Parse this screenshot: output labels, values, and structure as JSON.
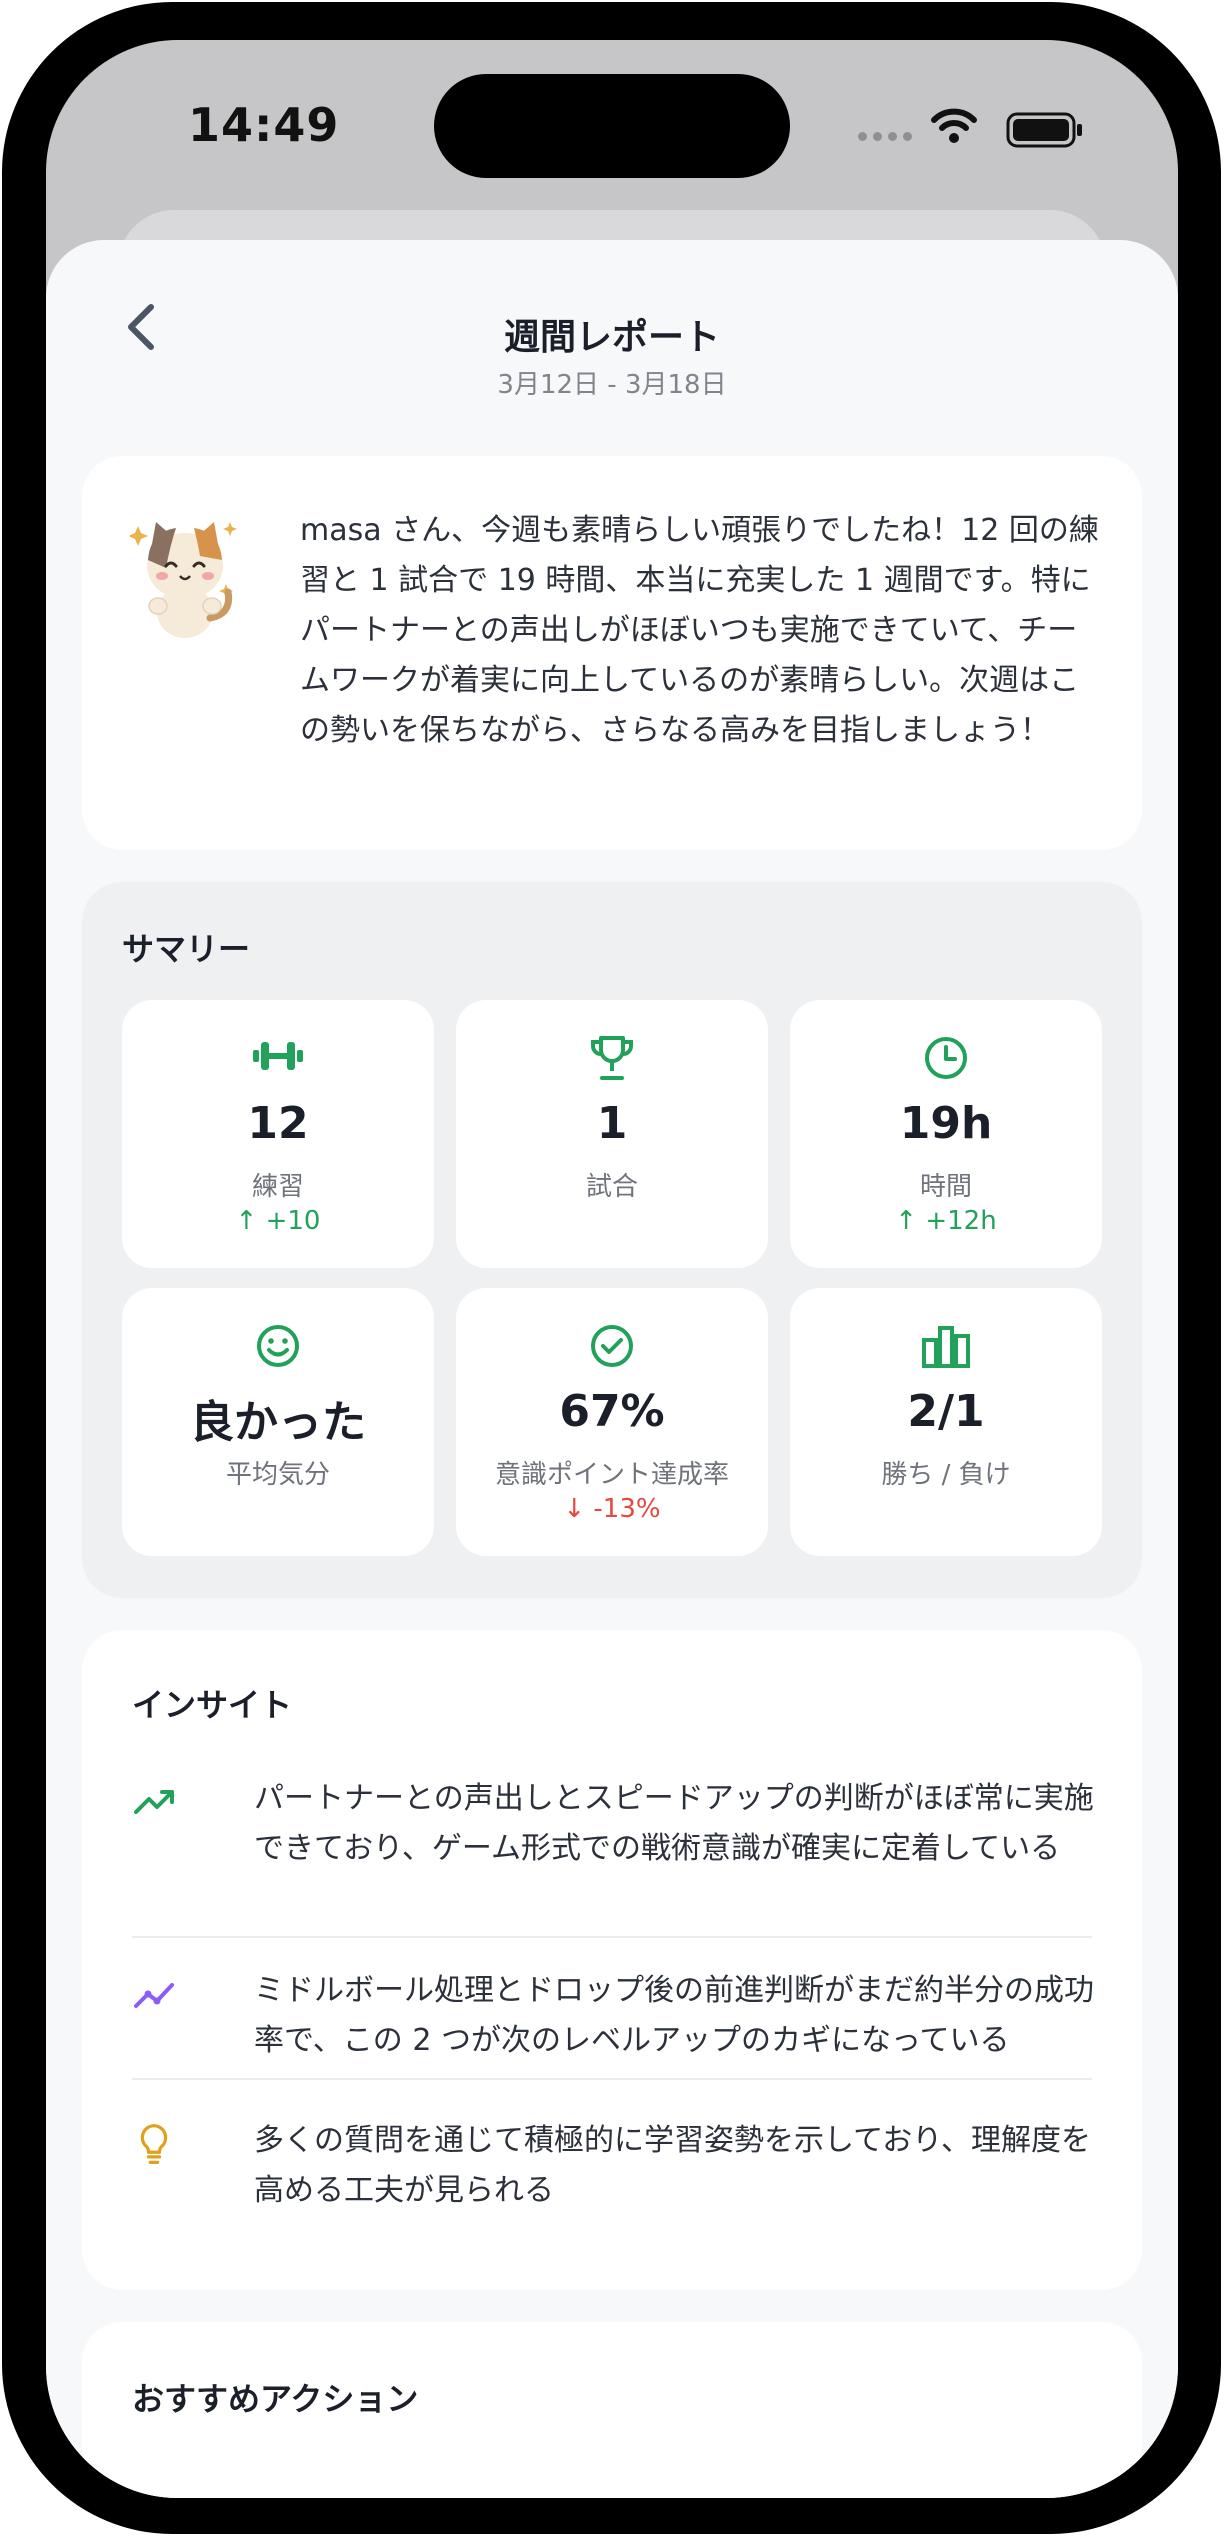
{
  "status_bar": {
    "time": "14:49"
  },
  "nav": {
    "title": "週間レポート",
    "subtitle": "3月12日 - 3月18日"
  },
  "message": {
    "text": "masa さん、今週も素晴らしい頑張りでしたね！12 回の練習と 1 試合で 19 時間、本当に充実した 1 週間です。特にパートナーとの声出しがほぼいつも実施できていて、チームワークが着実に向上しているのが素晴らしい。次週はこの勢いを保ちながら、さらなる高みを目指しましょう！"
  },
  "summary": {
    "title": "サマリー",
    "stats": [
      {
        "icon": "dumbbell-icon",
        "value": "12",
        "label": "練習",
        "change": "↑ +10",
        "trend": "up"
      },
      {
        "icon": "trophy-icon",
        "value": "1",
        "label": "試合",
        "change": "",
        "trend": ""
      },
      {
        "icon": "clock-icon",
        "value": "19h",
        "label": "時間",
        "change": "↑ +12h",
        "trend": "up"
      },
      {
        "icon": "smile-icon",
        "value": "良かった",
        "label": "平均気分",
        "change": "",
        "trend": ""
      },
      {
        "icon": "check-circle-icon",
        "value": "67%",
        "label": "意識ポイント達成率",
        "change": "↓ -13%",
        "trend": "down"
      },
      {
        "icon": "bar-chart-icon",
        "value": "2/1",
        "label": "勝ち / 負け",
        "change": "",
        "trend": ""
      }
    ]
  },
  "insights": {
    "title": "インサイト",
    "items": [
      {
        "icon": "trending-up-icon",
        "text": "パートナーとの声出しとスピードアップの判断がほぼ常に実施できており、ゲーム形式での戦術意識が確実に定着している"
      },
      {
        "icon": "line-chart-icon",
        "text": "ミドルボール処理とドロップ後の前進判断がまだ約半分の成功率で、この 2 つが次のレベルアップのカギになっている"
      },
      {
        "icon": "lightbulb-icon",
        "text": "多くの質問を通じて積極的に学習姿勢を示しており、理解度を高める工夫が見られる"
      }
    ]
  },
  "actions": {
    "title": "おすすめアクション"
  },
  "colors": {
    "accent_green": "#22a15a",
    "negative_red": "#e5483e",
    "purple": "#8b5cf6",
    "amber": "#e0a019"
  }
}
